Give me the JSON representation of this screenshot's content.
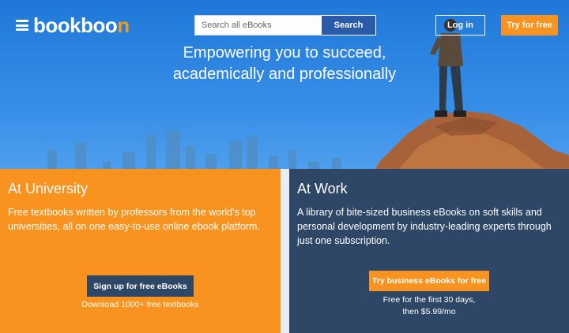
{
  "header": {
    "logo": {
      "main": "bookboo",
      "accent": "n"
    },
    "search": {
      "placeholder": "Search all eBooks",
      "button_label": "Search"
    },
    "login_label": "Log in",
    "try_label": "Try for free"
  },
  "hero": {
    "tagline_line1": "Empowering you to succeed,",
    "tagline_line2": "academically and professionally"
  },
  "university": {
    "title": "At University",
    "description": "Free textbooks written by professors from the world's top universities, all on one easy-to-use online ebook platform.",
    "cta_label": "Sign up for free eBooks",
    "note": "Download 1000+ free textbooks"
  },
  "work": {
    "title": "At Work",
    "description": "A library of bite-sized business eBooks on soft skills and personal development by industry-leading experts through just one subscription.",
    "cta_label": "Try business eBooks for free",
    "note_line1": "Free for the first 30 days,",
    "note_line2": "then $5.99/mo"
  },
  "colors": {
    "orange": "#f7931e",
    "navy": "#2e4766",
    "search_blue": "#2b5aa8"
  }
}
